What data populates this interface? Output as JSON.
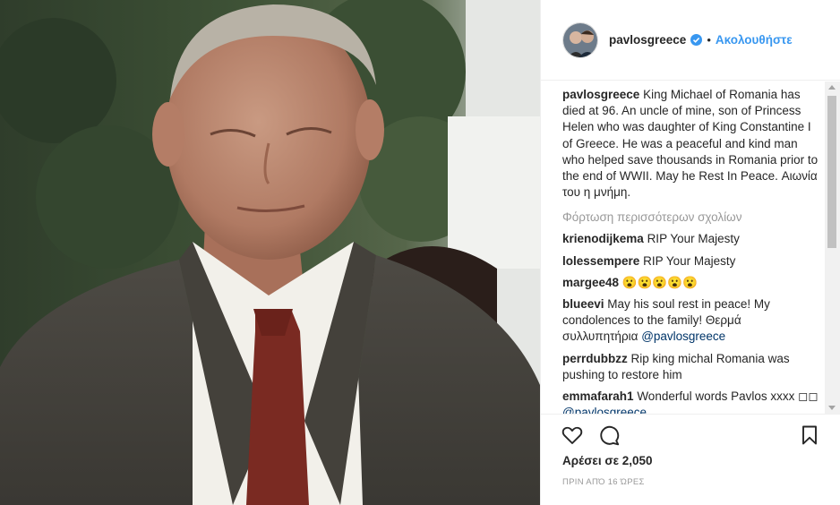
{
  "post": {
    "username": "pavlosgreece",
    "follow_label": "Ακολουθήστε",
    "separator": "•",
    "caption": {
      "username": "pavlosgreece",
      "text": "King Michael of Romania has died at 96. An uncle of mine, son of Princess Helen who was daughter of King Constantine I of Greece. He was a peaceful and kind man who helped save thousands in Romania prior to the end of WWII. May he Rest In Peace. Αιωνία του η μνήμη."
    },
    "load_more": "Φόρτωση περισσότερων σχολίων",
    "comments": [
      {
        "username": "krienodijkema",
        "text": "RIP Your Majesty",
        "mention": ""
      },
      {
        "username": "lolessempere",
        "text": "RIP Your Majesty",
        "mention": ""
      },
      {
        "username": "margee48",
        "text": "😮😮😮😮😮",
        "mention": ""
      },
      {
        "username": "blueevi",
        "text": "May his soul rest in peace! My condolences to the family! Θερμά συλλυπητήρια",
        "mention": "@pavlosgreece"
      },
      {
        "username": "perrdubbzz",
        "text": "Rip king michal Romania was pushing to restore him",
        "mention": ""
      },
      {
        "username": "emmafarah1",
        "text": "Wonderful words Pavlos xxxx ◻◻",
        "mention": "@pavlosgreece"
      }
    ],
    "likes": "Αρέσει σε 2,050",
    "timestamp": "ΠΡΙΝ ΑΠΌ 16 ΏΡΕΣ"
  },
  "icons": {
    "like": "heart-icon",
    "comment": "comment-icon",
    "save": "bookmark-icon",
    "verified": "verified-badge-icon"
  },
  "colors": {
    "link_blue": "#3897f0",
    "mention_blue": "#003569",
    "muted": "#999999",
    "text": "#262626",
    "verified": "#3897f0"
  }
}
